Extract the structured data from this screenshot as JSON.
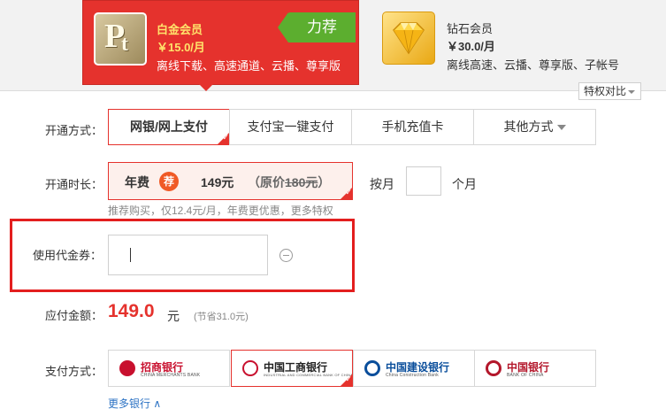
{
  "plans": {
    "platinum": {
      "name": "白金会员",
      "price": "￥15.0/月",
      "features": "离线下载、高速通道、云播、尊享版",
      "tag": "力荐",
      "icon": "pt-logo-icon"
    },
    "diamond": {
      "name": "钻石会员",
      "price": "￥30.0/月",
      "features": "离线高速、云播、尊享版、子帐号",
      "icon": "diamond-icon"
    },
    "compare_label": "特权对比"
  },
  "payment_method": {
    "label": "开通方式：",
    "options": [
      "网银/网上支付",
      "支付宝一键支付",
      "手机充值卡",
      "其他方式"
    ],
    "selected": "网银/网上支付"
  },
  "duration": {
    "label": "开通时长：",
    "annual_label": "年费",
    "recommend_badge": "荐",
    "annual_price": "149元",
    "original_prefix": "（原价",
    "original_price": "180元",
    "original_suffix": "）",
    "monthly_label": "按月",
    "months_value": "",
    "months_unit": "个月",
    "hint": "推荐购买，仅12.4元/月，年费更优惠，更多特权"
  },
  "coupon": {
    "label": "使用代金券：",
    "value": ""
  },
  "amount": {
    "label": "应付金额：",
    "value": "149.0",
    "unit": "元",
    "saved": "(节省31.0元)"
  },
  "bank": {
    "label": "支付方式：",
    "banks": [
      {
        "name": "招商银行",
        "sub": "CHINA MERCHANTS BANK",
        "color": "#c8102e"
      },
      {
        "name": "中国工商银行",
        "sub": "INDUSTRIAL AND COMMERCIAL BANK OF CHINA",
        "color": "#c8102e"
      },
      {
        "name": "中国建设银行",
        "sub": "China Construction Bank",
        "color": "#0a4e9b"
      },
      {
        "name": "中国银行",
        "sub": "BANK OF CHINA",
        "color": "#b3172b"
      }
    ],
    "selected": "中国工商银行",
    "more_label": "更多银行 ∧"
  }
}
